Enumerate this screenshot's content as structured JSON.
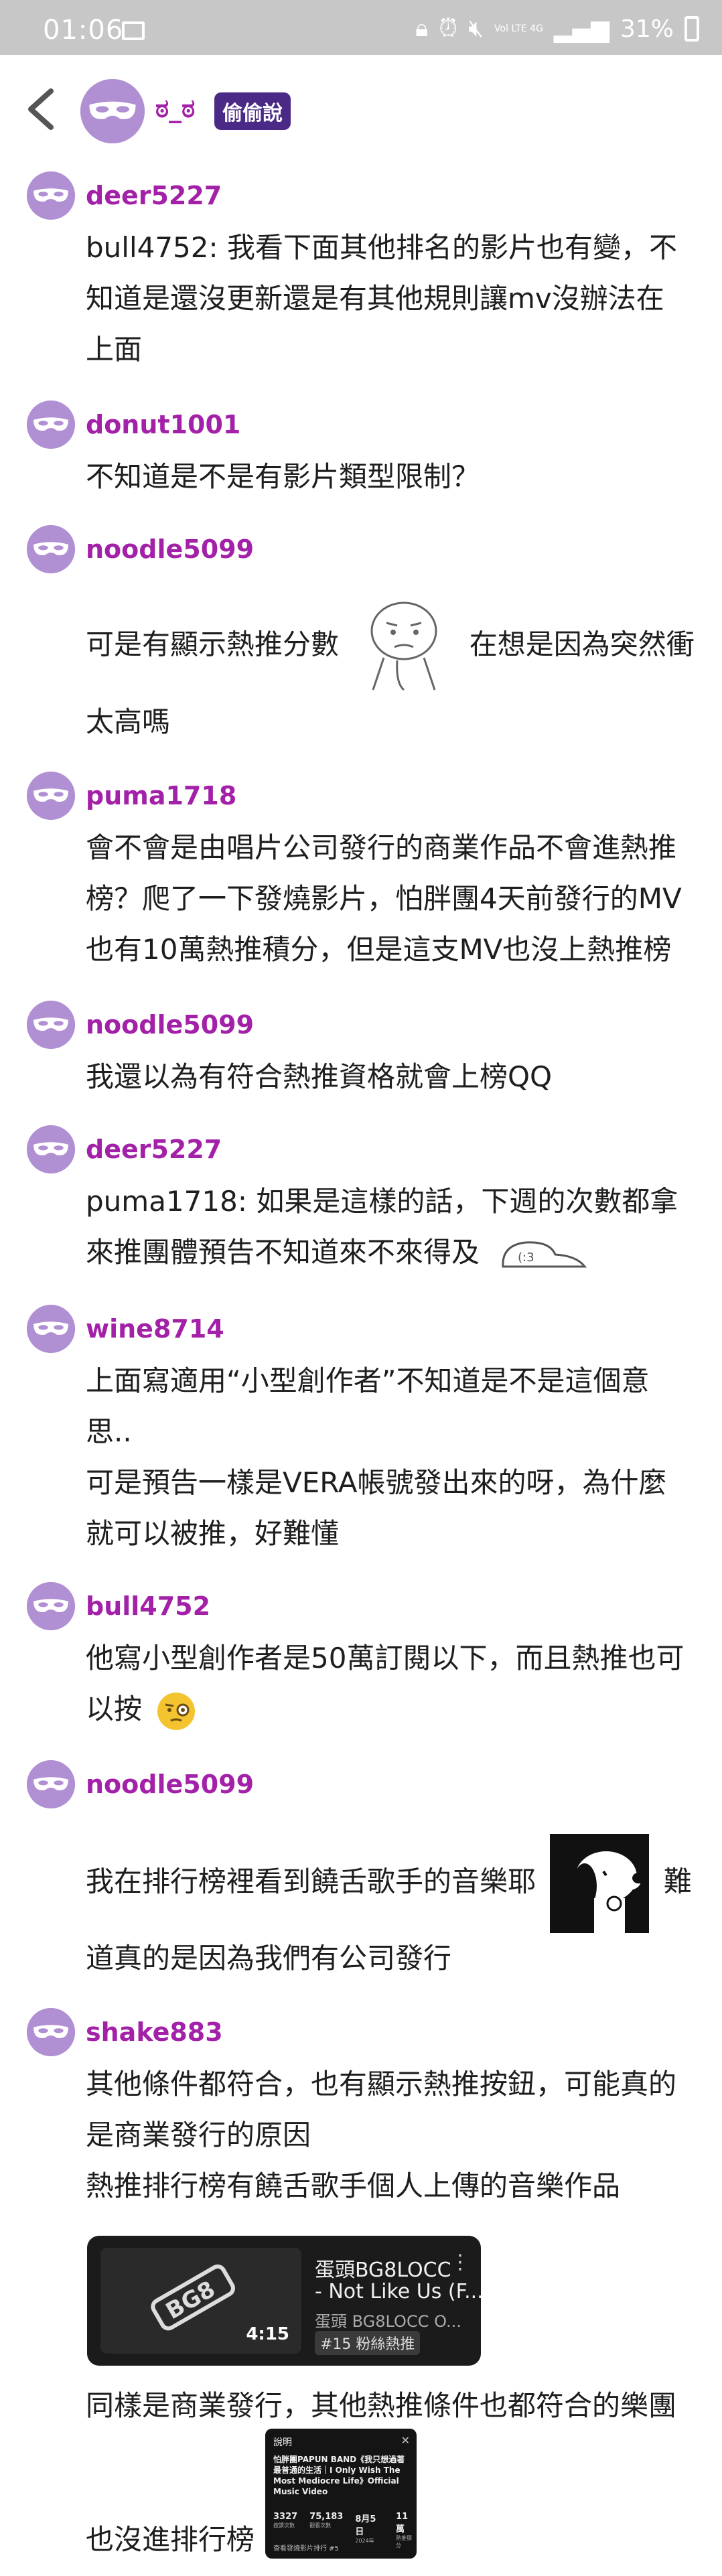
{
  "status_bar": {
    "time": "01:06",
    "network": "Vol LTE 4G",
    "battery": "31%"
  },
  "header": {
    "name": "ಠ_ಠ",
    "tag": "偷偷說"
  },
  "comments": [
    {
      "user": "deer5227",
      "lines": [
        "bull4752: 我看下面其他排名的影片也有變，不",
        "知道是還沒更新還是有其他規則讓mv沒辦法在",
        "上面"
      ]
    },
    {
      "user": "donut1001",
      "lines": [
        "不知道是不是有影片類型限制？"
      ]
    },
    {
      "user": "noodle5099",
      "line_a": "可是有顯示熱推分數",
      "line_b": "在想是因為突然衝",
      "line_c": "太高嗎"
    },
    {
      "user": "puma1718",
      "lines": [
        "會不會是由唱片公司發行的商業作品不會進熱推",
        "榜？爬了一下發燒影片，怕胖團4天前發行的MV",
        "也有10萬熱推積分，但是這支MV也沒上熱推榜"
      ]
    },
    {
      "user": "noodle5099",
      "lines": [
        "我還以為有符合熱推資格就會上榜QQ"
      ]
    },
    {
      "user": "deer5227",
      "lines": [
        "puma1718: 如果是這樣的話，下週的次數都拿"
      ],
      "line_last": "來推團體預告不知道來不來得及"
    },
    {
      "user": "wine8714",
      "lines": [
        "上面寫適用“小型創作者”不知道是不是這個意",
        "思..",
        "可是預告一樣是VERA帳號發出來的呀，為什麼",
        "就可以被推，好難懂"
      ]
    },
    {
      "user": "bull4752",
      "lines": [
        "他寫小型創作者是50萬訂閱以下，而且熱推也可"
      ],
      "line_last": "以按"
    },
    {
      "user": "noodle5099",
      "line_a": "我在排行榜裡看到饒舌歌手的音樂耶",
      "line_b": "難",
      "line_c": "道真的是因為我們有公司發行"
    },
    {
      "user": "shake883",
      "lines": [
        "其他條件都符合，也有顯示熱推按鈕，可能真的",
        "是商業發行的原因",
        "熱推排行榜有饒舌歌手個人上傳的音樂作品"
      ],
      "line_after_card": "同樣是商業發行，其他熱推條件也都符合的樂團",
      "line_final": "也沒進排行榜"
    }
  ],
  "video_card": {
    "duration": "4:15",
    "title_1": "蛋頭BG8LOCC",
    "title_2": "- Not Like Us (F...",
    "channel": "蛋頭 BG8LOCC O...",
    "badge": "#15 粉絲熱推"
  },
  "desc_card": {
    "header": "說明",
    "title": "怕胖團PAPUN BAND《我只想過著最普通的生活｜I Only Wish The Most Mediocre Life》Official Music Video",
    "stats": [
      {
        "value": "3327",
        "label": "按讚次數"
      },
      {
        "value": "75,183",
        "label": "觀看次數"
      },
      {
        "value": "8月5日",
        "label": "2024年"
      },
      {
        "value": "11萬",
        "label": "熱推積分"
      }
    ],
    "footer": "查看發燒影片排行 #5"
  },
  "colors": {
    "username": "#a321a8",
    "avatar": "#b08fd3",
    "tag_bg": "#4a2a86",
    "status_bar": "#c7c7c7"
  }
}
